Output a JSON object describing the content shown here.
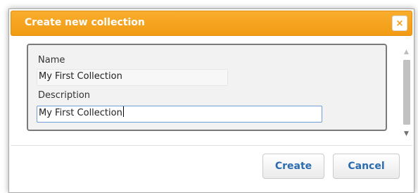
{
  "dialog": {
    "title": "Create new collection",
    "close_label": "×",
    "close_icon": "close-icon"
  },
  "form": {
    "name_label": "Name",
    "name_value": "My First Collection",
    "description_label": "Description",
    "description_value": "My First Collection"
  },
  "scrollbar": {
    "up_glyph": "▲",
    "down_glyph": "▼"
  },
  "buttons": {
    "create_label": "Create",
    "cancel_label": "Cancel"
  },
  "colors": {
    "titlebar": "#f29b12",
    "button_text": "#2b6cb0",
    "focus_border": "#6f9fd6"
  }
}
